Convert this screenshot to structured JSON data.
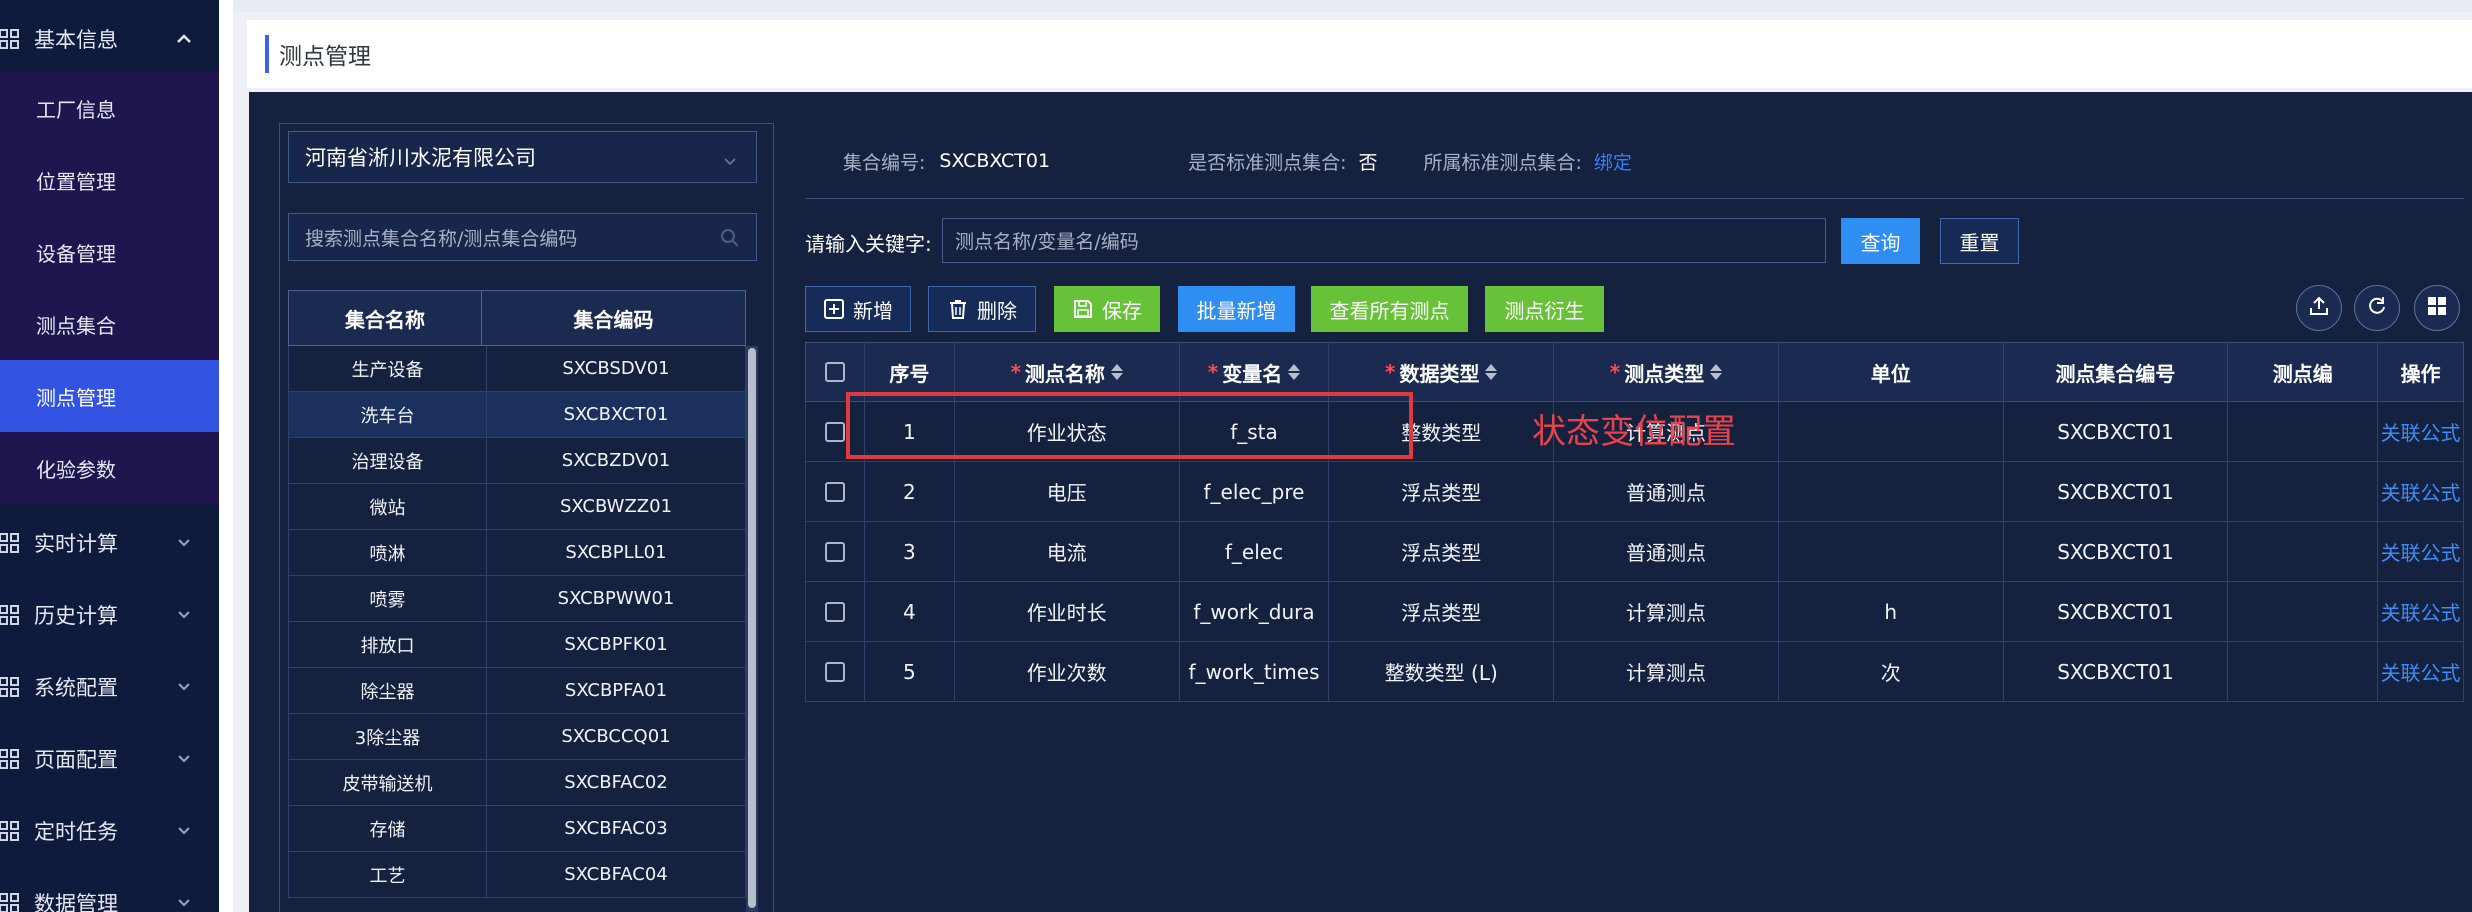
{
  "sidebar": {
    "groups": [
      {
        "label": "基本信息",
        "expanded": true
      },
      {
        "label": "实时计算"
      },
      {
        "label": "历史计算"
      },
      {
        "label": "系统配置"
      },
      {
        "label": "页面配置"
      },
      {
        "label": "定时任务"
      },
      {
        "label": "数据管理"
      }
    ],
    "sub_items": [
      "工厂信息",
      "位置管理",
      "设备管理",
      "测点集合",
      "测点管理",
      "化验参数"
    ],
    "active": "测点管理"
  },
  "header": {
    "title": "测点管理"
  },
  "left_panel": {
    "company": "河南省淅川水泥有限公司",
    "search_placeholder": "搜索测点集合名称/测点集合编码",
    "columns": [
      "集合名称",
      "集合编码"
    ],
    "rows": [
      {
        "name": "生产设备",
        "code": "SXCBSDV01"
      },
      {
        "name": "洗车台",
        "code": "SXCBXCT01",
        "selected": true
      },
      {
        "name": "治理设备",
        "code": "SXCBZDV01"
      },
      {
        "name": "微站",
        "code": "SXCBWZZ01"
      },
      {
        "name": "喷淋",
        "code": "SXCBPLL01"
      },
      {
        "name": "喷雾",
        "code": "SXCBPWW01"
      },
      {
        "name": "排放口",
        "code": "SXCBPFK01"
      },
      {
        "name": "除尘器",
        "code": "SXCBPFA01"
      },
      {
        "name": "3除尘器",
        "code": "SXCBCCQ01"
      },
      {
        "name": "皮带输送机",
        "code": "SXCBFAC02"
      },
      {
        "name": "存储",
        "code": "SXCBFAC03"
      },
      {
        "name": "工艺",
        "code": "SXCBFAC04"
      }
    ]
  },
  "info": {
    "set_code_label": "集合编号:",
    "set_code": "SXCBXCT01",
    "is_standard_label": "是否标准测点集合:",
    "is_standard": "否",
    "std_set_label": "所属标准测点集合:",
    "bind_link": "绑定"
  },
  "search": {
    "label": "请输入关键字:",
    "placeholder": "测点名称/变量名/编码",
    "query": "查询",
    "reset": "重置"
  },
  "toolbar": {
    "add": "新增",
    "delete": "删除",
    "save": "保存",
    "batch_add": "批量新增",
    "view_all": "查看所有测点",
    "derive": "测点衍生"
  },
  "table": {
    "headers": {
      "index": "序号",
      "name": "测点名称",
      "var": "变量名",
      "dtype": "数据类型",
      "ptype": "测点类型",
      "unit": "单位",
      "set_code": "测点集合编号",
      "code": "测点编",
      "op": "操作"
    },
    "rows": [
      {
        "index": "1",
        "name": "作业状态",
        "var": "f_sta",
        "dtype": "整数类型",
        "ptype": "计算测点",
        "unit": "",
        "set_code": "SXCBXCT01",
        "code": "",
        "op": "关联公式"
      },
      {
        "index": "2",
        "name": "电压",
        "var": "f_elec_pre",
        "dtype": "浮点类型",
        "ptype": "普通测点",
        "unit": "",
        "set_code": "SXCBXCT01",
        "code": "",
        "op": "关联公式"
      },
      {
        "index": "3",
        "name": "电流",
        "var": "f_elec",
        "dtype": "浮点类型",
        "ptype": "普通测点",
        "unit": "",
        "set_code": "SXCBXCT01",
        "code": "",
        "op": "关联公式"
      },
      {
        "index": "4",
        "name": "作业时长",
        "var": "f_work_dura",
        "dtype": "浮点类型",
        "ptype": "计算测点",
        "unit": "h",
        "set_code": "SXCBXCT01",
        "code": "",
        "op": "关联公式"
      },
      {
        "index": "5",
        "name": "作业次数",
        "var": "f_work_times",
        "dtype": "整数类型 (L)",
        "ptype": "计算测点",
        "unit": "次",
        "set_code": "SXCBXCT01",
        "code": "",
        "op": "关联公式"
      }
    ]
  },
  "annotation": {
    "text": "状态变位配置"
  },
  "colors": {
    "accent": "#3354e2",
    "green": "#67c23a",
    "blue": "#2f8ef2",
    "red": "#e03a3e",
    "link": "#3d8df5"
  }
}
